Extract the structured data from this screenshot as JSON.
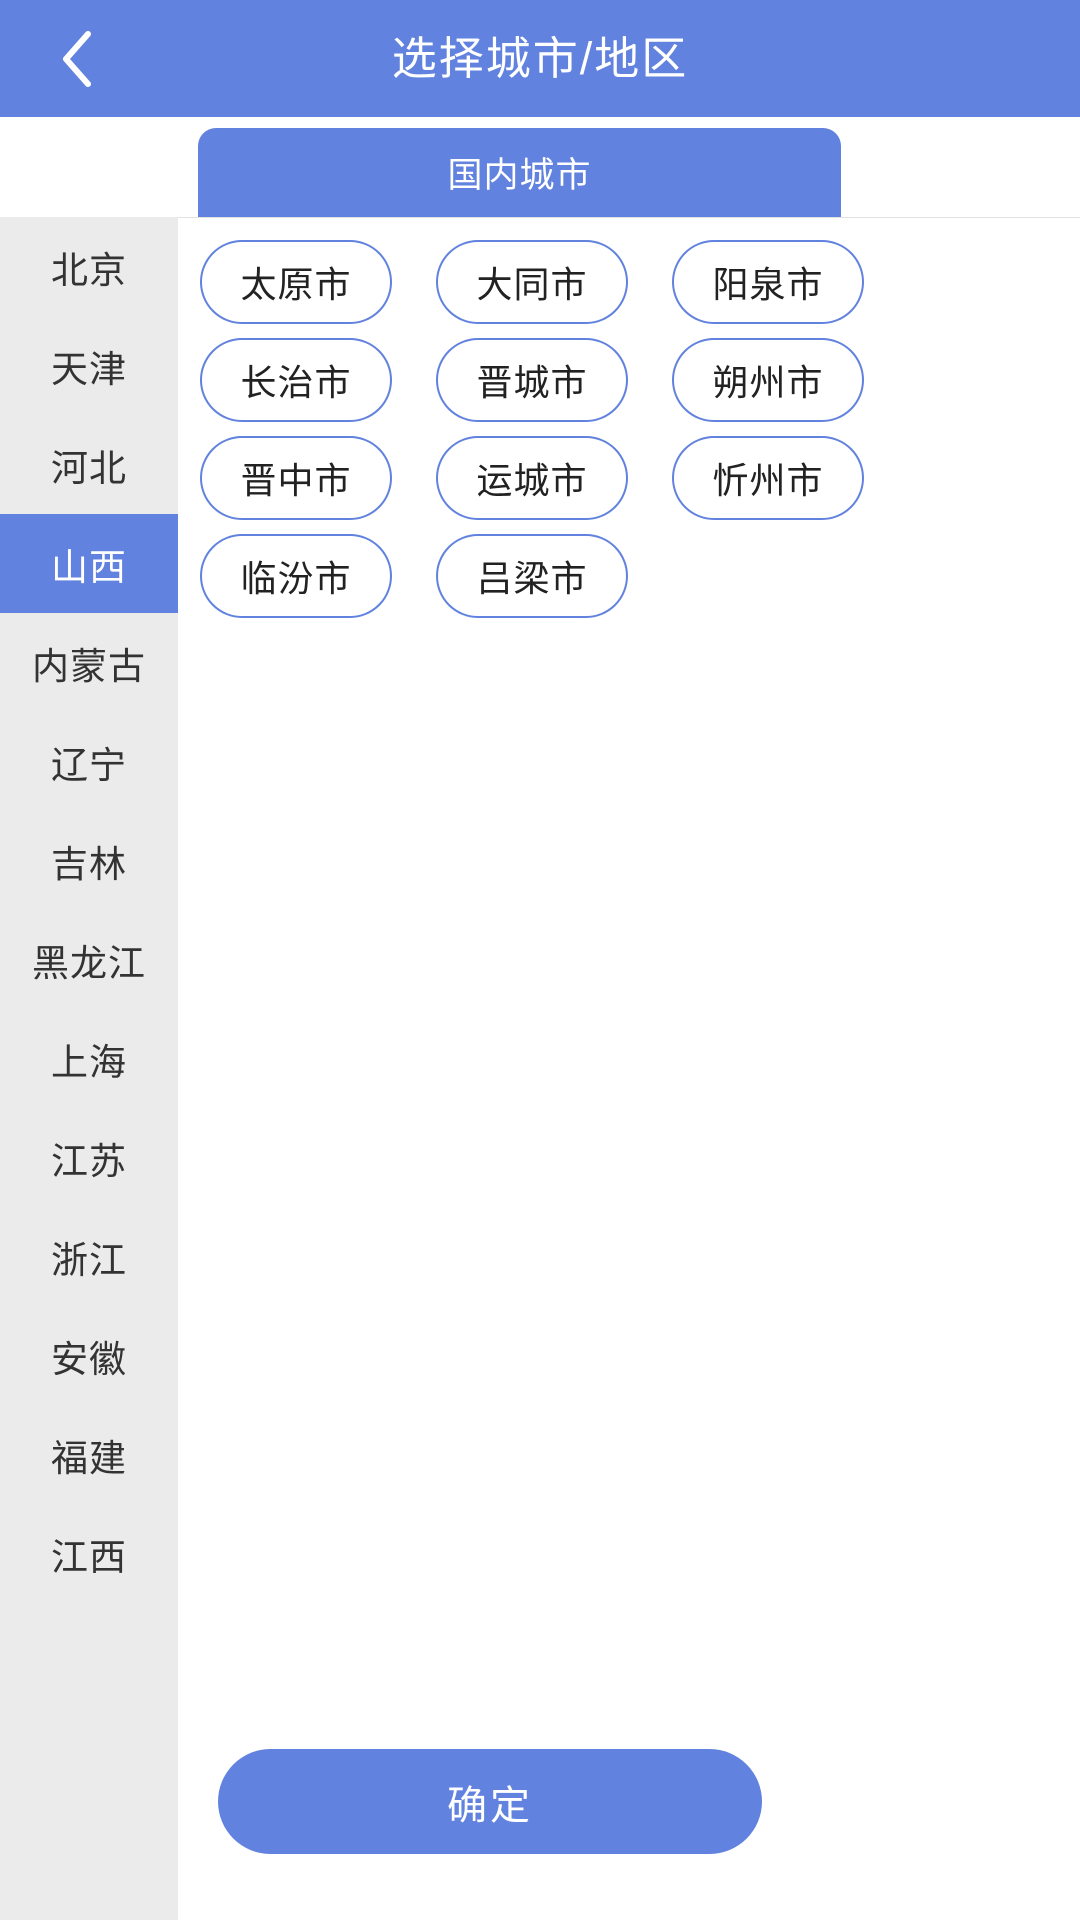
{
  "header": {
    "title": "选择城市/地区",
    "back_icon": "chevron-left-icon",
    "bg_color": "#6182DE",
    "text_color": "#FFFFFF"
  },
  "tabs": {
    "items": [
      {
        "label": "国内城市",
        "selected": true
      }
    ],
    "active_label": "国内城市",
    "active_color": "#6182DE"
  },
  "sidebar": {
    "bg_color": "#EBEBEB",
    "selected_color": "#6182DE",
    "selected_index": 3,
    "items": [
      {
        "label": "北京"
      },
      {
        "label": "天津"
      },
      {
        "label": "河北"
      },
      {
        "label": "山西"
      },
      {
        "label": "内蒙古"
      },
      {
        "label": "辽宁"
      },
      {
        "label": "吉林"
      },
      {
        "label": "黑龙江"
      },
      {
        "label": "上海"
      },
      {
        "label": "江苏"
      },
      {
        "label": "浙江"
      },
      {
        "label": "安徽"
      },
      {
        "label": "福建"
      },
      {
        "label": "江西"
      }
    ]
  },
  "cities": {
    "province": "山西",
    "border_color": "#6182DE",
    "items": [
      {
        "label": "太原市"
      },
      {
        "label": "大同市"
      },
      {
        "label": "阳泉市"
      },
      {
        "label": "长治市"
      },
      {
        "label": "晋城市"
      },
      {
        "label": "朔州市"
      },
      {
        "label": "晋中市"
      },
      {
        "label": "运城市"
      },
      {
        "label": "忻州市"
      },
      {
        "label": "临汾市"
      },
      {
        "label": "吕梁市"
      }
    ]
  },
  "footer": {
    "confirm_label": "确定",
    "confirm_color": "#6182DE"
  }
}
